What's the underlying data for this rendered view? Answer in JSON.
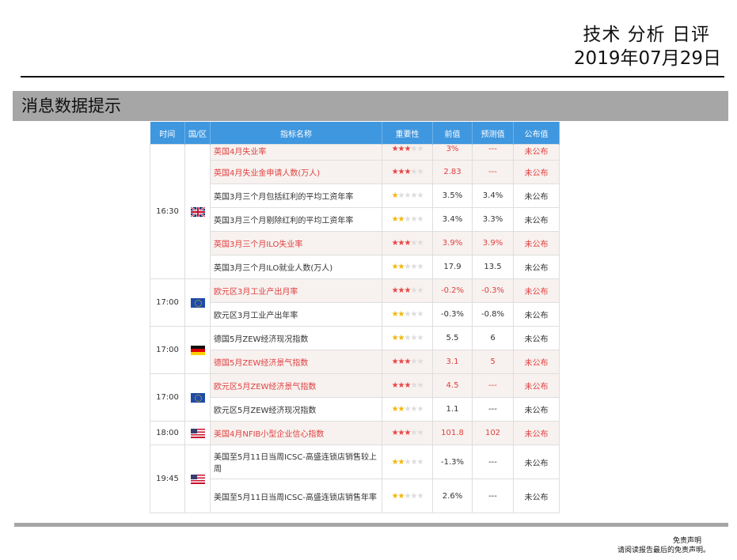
{
  "header": {
    "title": "技术 分析 日评",
    "date": "2019年07月29日"
  },
  "section": {
    "title": "消息数据提示"
  },
  "table": {
    "columns": [
      "时间",
      "国/区",
      "指标名称",
      "重要性",
      "前值",
      "预测值",
      "公布值"
    ],
    "groups": [
      {
        "time": "16:30",
        "flag": "uk-flag-icon",
        "rows": [
          {
            "name": "英国4月失业率",
            "stars": 3,
            "prev": "3%",
            "forecast": "---",
            "actual": "未公布"
          },
          {
            "name": "英国4月失业金申请人数(万人)",
            "stars": 3,
            "prev": "2.83",
            "forecast": "---",
            "actual": "未公布"
          },
          {
            "name": "英国3月三个月包括红利的平均工资年率",
            "stars": 1,
            "prev": "3.5%",
            "forecast": "3.4%",
            "actual": "未公布"
          },
          {
            "name": "英国3月三个月剔除红利的平均工资年率",
            "stars": 2,
            "prev": "3.4%",
            "forecast": "3.3%",
            "actual": "未公布"
          },
          {
            "name": "英国3月三个月ILO失业率",
            "stars": 3,
            "prev": "3.9%",
            "forecast": "3.9%",
            "actual": "未公布"
          },
          {
            "name": "英国3月三个月ILO就业人数(万人)",
            "stars": 2,
            "prev": "17.9",
            "forecast": "13.5",
            "actual": "未公布"
          }
        ]
      },
      {
        "time": "17:00",
        "flag": "eu-flag-icon",
        "rows": [
          {
            "name": "欧元区3月工业产出月率",
            "stars": 3,
            "prev": "-0.2%",
            "forecast": "-0.3%",
            "actual": "未公布"
          },
          {
            "name": "欧元区3月工业产出年率",
            "stars": 2,
            "prev": "-0.3%",
            "forecast": "-0.8%",
            "actual": "未公布"
          }
        ]
      },
      {
        "time": "17:00",
        "flag": "de-flag-icon",
        "rows": [
          {
            "name": "德国5月ZEW经济现况指数",
            "stars": 2,
            "prev": "5.5",
            "forecast": "6",
            "actual": "未公布"
          },
          {
            "name": "德国5月ZEW经济景气指数",
            "stars": 3,
            "prev": "3.1",
            "forecast": "5",
            "actual": "未公布"
          }
        ]
      },
      {
        "time": "17:00",
        "flag": "eu-flag-icon",
        "rows": [
          {
            "name": "欧元区5月ZEW经济景气指数",
            "stars": 3,
            "prev": "4.5",
            "forecast": "---",
            "actual": "未公布"
          },
          {
            "name": "欧元区5月ZEW经济现况指数",
            "stars": 2,
            "prev": "1.1",
            "forecast": "---",
            "actual": "未公布"
          }
        ]
      },
      {
        "time": "18:00",
        "flag": "us-flag-icon",
        "rows": [
          {
            "name": "美国4月NFIB小型企业信心指数",
            "stars": 3,
            "prev": "101.8",
            "forecast": "102",
            "actual": "未公布"
          }
        ]
      },
      {
        "time": "19:45",
        "flag": "us-flag-icon",
        "rows": [
          {
            "name": "美国至5月11日当周ICSC-高盛连锁店销售较上周",
            "stars": 2,
            "prev": "-1.3%",
            "forecast": "---",
            "actual": "未公布"
          },
          {
            "name": "美国至5月11日当周ICSC-高盛连锁店销售年率",
            "stars": 2,
            "prev": "2.6%",
            "forecast": "---",
            "actual": "未公布"
          }
        ]
      }
    ]
  },
  "footer": {
    "line1": "免责声明",
    "line2": "请阅读报告最后的免责声明。"
  }
}
